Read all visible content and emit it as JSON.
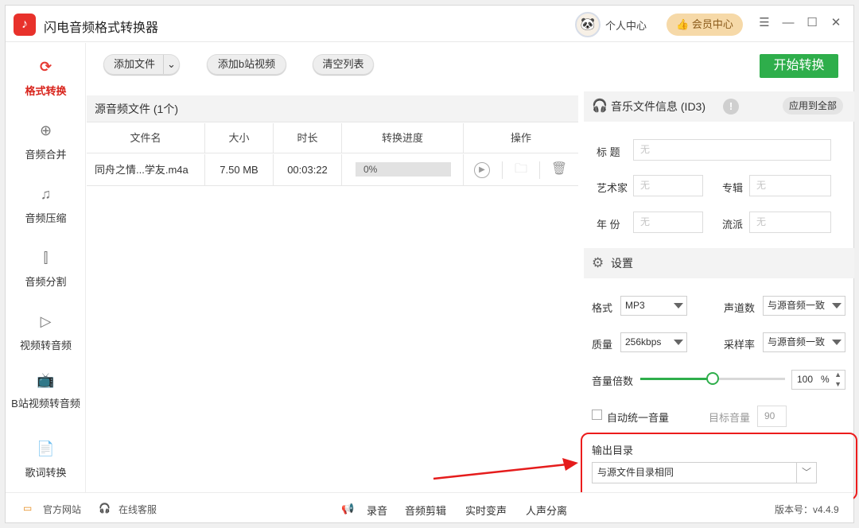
{
  "app": {
    "title": "闪电音频格式转换器"
  },
  "header": {
    "user_center": "个人中心",
    "vip": "会员中心"
  },
  "sidebar": {
    "items": [
      {
        "label": "格式转换"
      },
      {
        "label": "音频合并"
      },
      {
        "label": "音频压缩"
      },
      {
        "label": "音频分割"
      },
      {
        "label": "视频转音频"
      },
      {
        "label": "B站视频转音频"
      },
      {
        "label": "歌词转换"
      }
    ]
  },
  "toolbar": {
    "add_file": "添加文件",
    "add_bilibili": "添加b站视频",
    "clear_list": "清空列表",
    "start": "开始转换"
  },
  "file_list": {
    "header": "源音频文件 (1个)",
    "columns": [
      "文件名",
      "大小",
      "时长",
      "转换进度",
      "操作"
    ],
    "rows": [
      {
        "name": "同舟之情...学友.m4a",
        "size": "7.50 MB",
        "duration": "00:03:22",
        "progress": "0%"
      }
    ]
  },
  "music_info": {
    "title": "音乐文件信息 (ID3)",
    "apply_all": "应用到全部",
    "fields": {
      "title_label": "标  题",
      "artist_label": "艺术家",
      "album_label": "专辑",
      "year_label": "年  份",
      "genre_label": "流派",
      "placeholder": "无"
    }
  },
  "settings": {
    "title": "设置",
    "format_label": "格式",
    "format_value": "MP3",
    "channel_label": "声道数",
    "channel_value": "与源音频一致",
    "quality_label": "质量",
    "quality_value": "256kbps",
    "samplerate_label": "采样率",
    "samplerate_value": "与源音频一致",
    "volume_label": "音量倍数",
    "volume_value": "100",
    "volume_unit": "%",
    "volume_level": 0.5,
    "auto_volume_label": "自动统一音量",
    "target_volume_label": "目标音量",
    "target_volume_value": "90"
  },
  "output": {
    "label": "输出目录",
    "value": "与源文件目录相同"
  },
  "footer": {
    "website": "官方网站",
    "service": "在线客服",
    "record": "录音",
    "edit": "音频剪辑",
    "realtime": "实时变声",
    "separate": "人声分离",
    "version": "版本号：v4.4.9"
  }
}
